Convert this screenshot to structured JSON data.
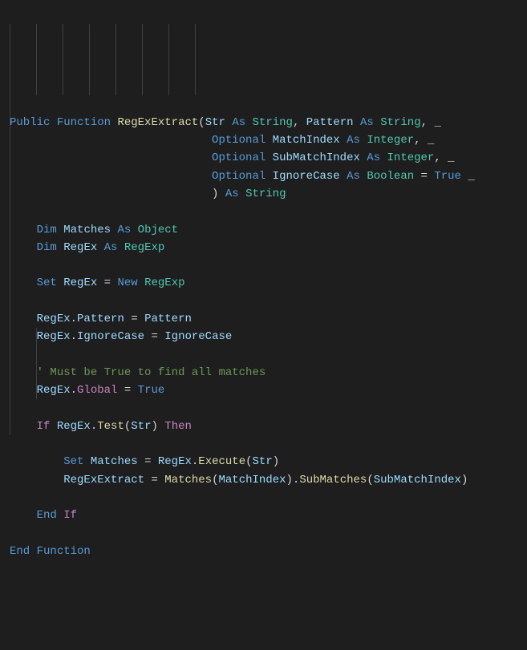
{
  "code": {
    "l1": {
      "public": "Public",
      "function": "Function",
      "name": "RegExExtract",
      "p1v": "Str",
      "as": "As",
      "t_string": "String",
      "comma": ",",
      "p2v": "Pattern",
      "underscore": "_"
    },
    "l2": {
      "optional": "Optional",
      "v": "MatchIndex",
      "as": "As",
      "t": "Integer",
      "comma": ",",
      "underscore": "_"
    },
    "l3": {
      "optional": "Optional",
      "v": "SubMatchIndex",
      "as": "As",
      "t": "Integer",
      "comma": ",",
      "underscore": "_"
    },
    "l4": {
      "optional": "Optional",
      "v": "IgnoreCase",
      "as": "As",
      "t": "Boolean",
      "eq": "=",
      "val": "True",
      "underscore": "_"
    },
    "l5": {
      "paren": ")",
      "as": "As",
      "t": "String"
    },
    "l7": {
      "dim": "Dim",
      "v": "Matches",
      "as": "As",
      "t": "Object"
    },
    "l8": {
      "dim": "Dim",
      "v": "RegEx",
      "as": "As",
      "t": "RegExp"
    },
    "l10": {
      "set": "Set",
      "v": "RegEx",
      "eq": "=",
      "new": "New",
      "t": "RegExp"
    },
    "l12": {
      "obj": "RegEx",
      "dot": ".",
      "prop": "Pattern",
      "eq": "=",
      "v": "Pattern"
    },
    "l13": {
      "obj": "RegEx",
      "dot": ".",
      "prop": "IgnoreCase",
      "eq": "=",
      "v": "IgnoreCase"
    },
    "l15": {
      "comment": "' Must be True to find all matches"
    },
    "l16": {
      "obj": "RegEx",
      "dot": ".",
      "prop": "Global",
      "eq": "=",
      "v": "True"
    },
    "l18": {
      "if": "If",
      "obj": "RegEx",
      "dot": ".",
      "m": "Test",
      "arg": "Str",
      "then": "Then"
    },
    "l20": {
      "set": "Set",
      "v": "Matches",
      "eq": "=",
      "obj": "RegEx",
      "dot": ".",
      "m": "Execute",
      "arg": "Str"
    },
    "l21": {
      "lhs": "RegExExtract",
      "eq": "=",
      "obj": "Matches",
      "arg1": "MatchIndex",
      "dot": ".",
      "m": "SubMatches",
      "arg2": "SubMatchIndex"
    },
    "l23": {
      "end": "End",
      "if": "If"
    },
    "l25": {
      "end": "End",
      "function": "Function"
    }
  }
}
